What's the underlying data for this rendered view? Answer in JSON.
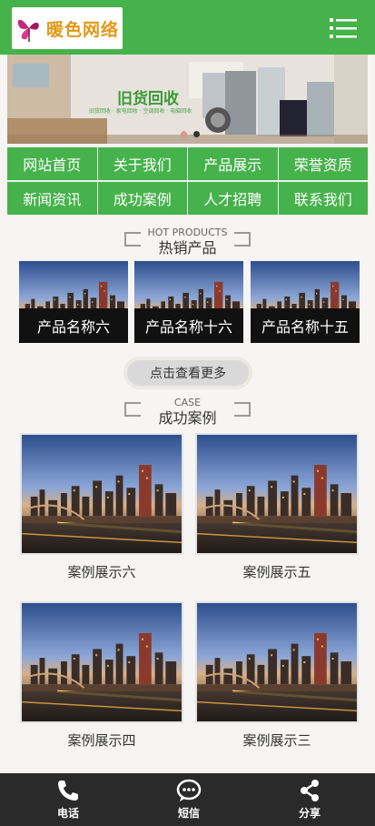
{
  "header": {
    "logo_text": "暖色网络"
  },
  "banner": {
    "title": "旧货回收",
    "subtitle": "旧货回收 · 家电回收 · 空调回收 · 电脑回收"
  },
  "nav": {
    "items": [
      {
        "label": "网站首页"
      },
      {
        "label": "关于我们"
      },
      {
        "label": "产品展示"
      },
      {
        "label": "荣誉资质"
      },
      {
        "label": "新闻资讯"
      },
      {
        "label": "成功案例"
      },
      {
        "label": "人才招聘"
      },
      {
        "label": "联系我们"
      }
    ]
  },
  "products_section": {
    "en": "HOT PRODUCTS",
    "zh": "热销产品"
  },
  "products": [
    {
      "name": "产品名称六"
    },
    {
      "name": "产品名称十六"
    },
    {
      "name": "产品名称十五"
    }
  ],
  "more_button": "点击查看更多",
  "case_section": {
    "en": "CASE",
    "zh": "成功案例"
  },
  "cases": [
    {
      "name": "案例展示六"
    },
    {
      "name": "案例展示五"
    },
    {
      "name": "案例展示四"
    },
    {
      "name": "案例展示三"
    }
  ],
  "bottom_bar": {
    "items": [
      {
        "label": "电话",
        "icon": "phone-icon"
      },
      {
        "label": "短信",
        "icon": "chat-icon"
      },
      {
        "label": "分享",
        "icon": "share-icon"
      }
    ]
  },
  "colors": {
    "brand_green": "#46b24b",
    "bottom_bar": "#2a2a2a",
    "logo_orange": "#e09a17"
  }
}
